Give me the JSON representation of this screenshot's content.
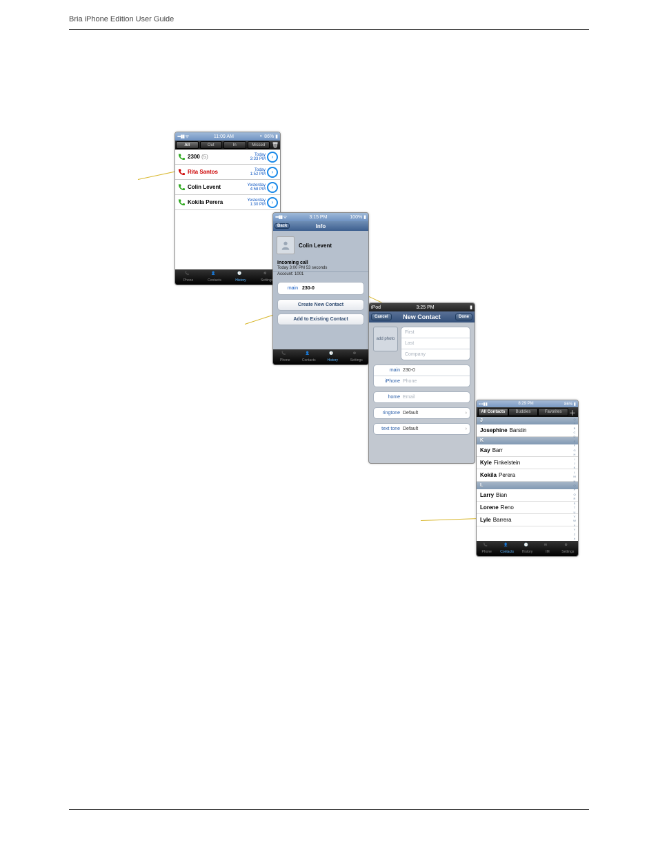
{
  "doc": {
    "header_left": "Bria iPhone Edition User Guide",
    "header_right": "",
    "section_title": "",
    "footer_left": "",
    "footer_right": ""
  },
  "screen1": {
    "status_time": "11:09 AM",
    "status_batt": "86%",
    "seg": [
      "All",
      "Out",
      "In",
      "Missed"
    ],
    "seg_active": 0,
    "rows": [
      {
        "icon": "out",
        "name": "2300",
        "count": "(5)",
        "day": "Today",
        "time": "3:33 PM",
        "missed": false
      },
      {
        "icon": "missed",
        "name": "Rita Santos",
        "count": "",
        "day": "Today",
        "time": "1:52 PM",
        "missed": true
      },
      {
        "icon": "in",
        "name": "Colin Levent",
        "count": "",
        "day": "Yesterday",
        "time": "4:58 PM",
        "missed": false
      },
      {
        "icon": "in",
        "name": "Kokila Perera",
        "count": "",
        "day": "Yesterday",
        "time": "1:30 PM",
        "missed": false
      }
    ],
    "tabs": [
      "Phone",
      "Contacts",
      "History",
      "Settings"
    ],
    "tab_active": 2
  },
  "screen2": {
    "status_time": "3:15 PM",
    "status_batt": "100%",
    "back": "Back",
    "title": "Info",
    "name": "Colin Levent",
    "sub_head": "Incoming call",
    "sub_line": "Today 3:00 PM   53 seconds",
    "sub_acct": "Account: 1001",
    "field_label": "main",
    "field_value": "230-0",
    "btn1": "Create New Contact",
    "btn2": "Add to Existing Contact",
    "tabs": [
      "Phone",
      "Contacts",
      "History",
      "Settings"
    ],
    "tab_active": 2
  },
  "screen3": {
    "status_left": "iPod",
    "status_time": "3:25 PM",
    "cancel": "Cancel",
    "title": "New Contact",
    "done": "Done",
    "add_photo": "add photo",
    "fields": [
      "First",
      "Last",
      "Company"
    ],
    "phones": [
      {
        "k": "main",
        "v": "230-0",
        "ph": false,
        "del": true
      },
      {
        "k": "iPhone",
        "v": "Phone",
        "ph": true,
        "del": false
      }
    ],
    "emails": [
      {
        "k": "home",
        "v": "Email",
        "ph": true
      }
    ],
    "ringtone_k": "ringtone",
    "ringtone_v": "Default",
    "texttone_k": "text tone",
    "texttone_v": "Default"
  },
  "screen4": {
    "status_time": "8:29 PM",
    "status_batt": "86%",
    "seg": [
      "All Contacts",
      "Buddies",
      "Favorites"
    ],
    "seg_active": 0,
    "sections": [
      {
        "letter": "J",
        "rows": [
          {
            "first": "Josephine",
            "last": "Barstin"
          }
        ]
      },
      {
        "letter": "K",
        "rows": [
          {
            "first": "Kay",
            "last": "Barr"
          },
          {
            "first": "Kyle",
            "last": "Finkelstein"
          },
          {
            "first": "Kokila",
            "last": "Perera"
          }
        ]
      },
      {
        "letter": "L",
        "rows": [
          {
            "first": "Larry",
            "last": "Bian"
          },
          {
            "first": "Lorene",
            "last": "Reno"
          },
          {
            "first": "Lyle",
            "last": "Barrera"
          }
        ]
      }
    ],
    "index": [
      "Q",
      "A",
      "B",
      "C",
      "D",
      "E",
      "F",
      "G",
      "H",
      "I",
      "J",
      "K",
      "L",
      "M",
      "N",
      "O",
      "P",
      "Q",
      "R",
      "S",
      "T",
      "U",
      "V",
      "W",
      "X",
      "Y",
      "Z",
      "#"
    ],
    "tabs": [
      "Phone",
      "Contacts",
      "History",
      "IM",
      "Settings"
    ],
    "tab_active": 1
  }
}
